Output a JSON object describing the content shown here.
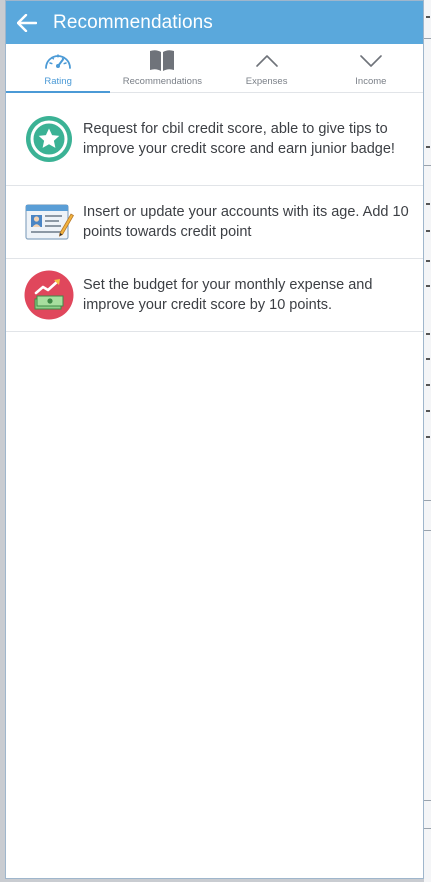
{
  "header": {
    "title": "Recommendations",
    "back_icon": "arrow-left-icon",
    "bar_color": "#5aa8dc"
  },
  "tabs": [
    {
      "label": "Rating",
      "icon": "speedometer-icon",
      "active": true
    },
    {
      "label": "Recommendations",
      "icon": "book-icon",
      "active": false
    },
    {
      "label": "Expenses",
      "icon": "chevron-up-icon",
      "active": false
    },
    {
      "label": "Income",
      "icon": "chevron-down-icon",
      "active": false
    }
  ],
  "recommendations": [
    {
      "text": "Request for cbil credit score, able to give tips to improve your credit score and earn junior badge!",
      "icon": "star-badge-icon",
      "icon_color": "#3bb295"
    },
    {
      "text": "Insert or update your accounts with its age. Add 10 points towards credit point",
      "icon": "account-card-icon"
    },
    {
      "text": "Set the budget for your monthly expense and improve your credit score by 10 points.",
      "icon": "money-growth-icon",
      "icon_color": "#e0475c"
    }
  ],
  "accent_color": "#4b9ad6"
}
